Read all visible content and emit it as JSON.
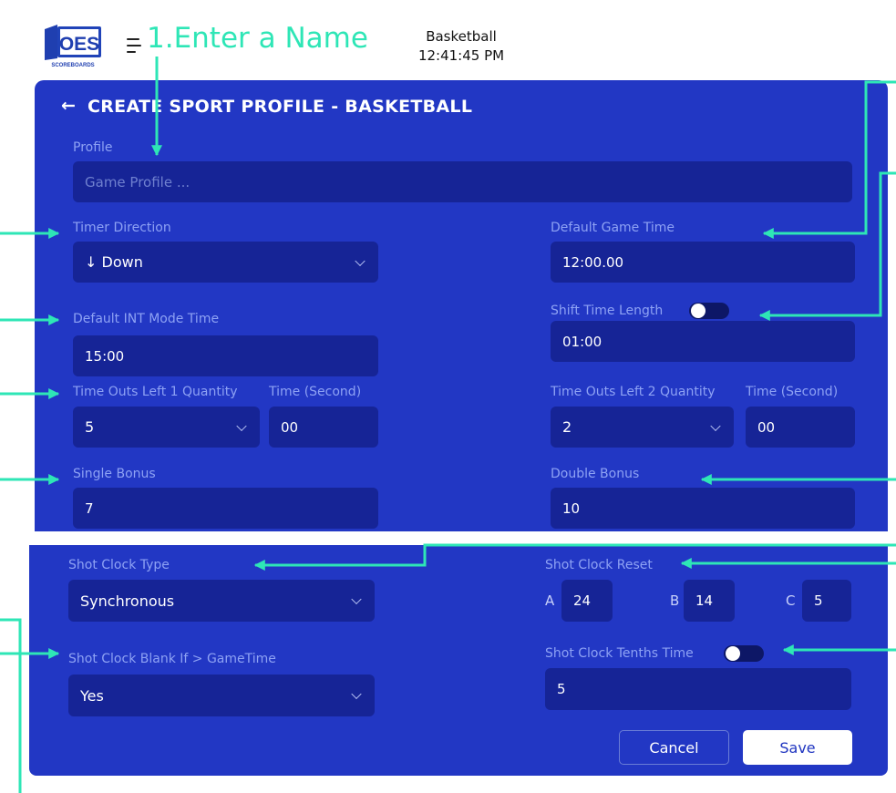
{
  "header": {
    "logo_text": "OES",
    "logo_subtext": "SCOREBOARDS",
    "annotation": "1.Enter a Name",
    "sport": "Basketball",
    "time": "12:41:45 PM"
  },
  "form": {
    "title": "CREATE SPORT PROFILE - BASKETBALL",
    "back_icon": "←",
    "profile": {
      "label": "Profile",
      "placeholder": "Game Profile ..."
    },
    "timer_direction": {
      "label": "Timer Direction",
      "value": "↓ Down"
    },
    "default_game_time": {
      "label": "Default Game Time",
      "value": "12:00.00"
    },
    "default_int_mode_time": {
      "label": "Default INT Mode Time",
      "value": "15:00"
    },
    "shift_time_length": {
      "label": "Shift Time Length",
      "value": "01:00"
    },
    "time_outs_left_1": {
      "label": "Time Outs Left 1 Quantity",
      "value": "5",
      "time_label": "Time (Second)",
      "time_value": "00"
    },
    "time_outs_left_2": {
      "label": "Time Outs Left 2 Quantity",
      "value": "2",
      "time_label": "Time (Second)",
      "time_value": "00"
    },
    "single_bonus": {
      "label": "Single Bonus",
      "value": "7"
    },
    "double_bonus": {
      "label": "Double Bonus",
      "value": "10"
    },
    "shot_clock_type": {
      "label": "Shot Clock Type",
      "value": "Synchronous"
    },
    "shot_clock_reset": {
      "label": "Shot Clock Reset",
      "a_label": "A",
      "a_value": "24",
      "b_label": "B",
      "b_value": "14",
      "c_label": "C",
      "c_value": "5"
    },
    "shot_clock_blank": {
      "label": "Shot Clock Blank If > GameTime",
      "value": "Yes"
    },
    "shot_clock_tenths": {
      "label": "Shot Clock Tenths Time",
      "value": "5"
    },
    "cancel_label": "Cancel",
    "save_label": "Save"
  },
  "colors": {
    "panel": "#2237c4",
    "field": "#162496",
    "label": "#8ea2f4",
    "annotation": "#2ee6b6"
  }
}
